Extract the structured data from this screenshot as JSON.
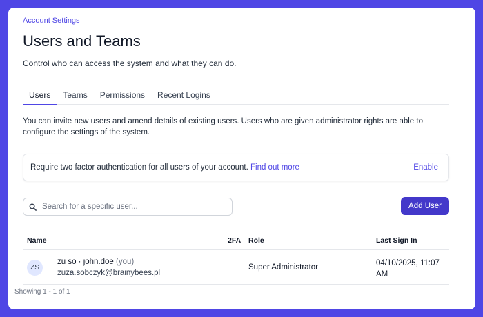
{
  "breadcrumb": "Account Settings",
  "page_title": "Users and Teams",
  "subtitle": "Control who can access the system and what they can do.",
  "tabs": [
    {
      "label": "Users",
      "active": true
    },
    {
      "label": "Teams",
      "active": false
    },
    {
      "label": "Permissions",
      "active": false
    },
    {
      "label": "Recent Logins",
      "active": false
    }
  ],
  "intro": "You can invite new users and amend details of existing users. Users who are given administrator rights are able to configure the settings of the system.",
  "notice": {
    "text": "Require two factor authentication for all users of your account.",
    "link": "Find out more",
    "action": "Enable"
  },
  "search": {
    "placeholder": "Search for a specific user...",
    "value": "",
    "icon": "search-icon"
  },
  "add_user_label": "Add User",
  "table": {
    "headers": {
      "name": "Name",
      "twofa": "2FA",
      "role": "Role",
      "last_sign_in": "Last Sign In"
    },
    "rows": [
      {
        "initials": "ZS",
        "name": "zu so · john.doe",
        "you_tag": "(you)",
        "email": "zuza.sobczyk@brainybees.pl",
        "twofa": "",
        "role": "Super Administrator",
        "last_sign_in": "04/10/2025, 11:07 AM"
      }
    ]
  },
  "footer": "Showing 1 - 1 of 1",
  "colors": {
    "accent": "#4f46e5",
    "background": "#4f46e5",
    "button": "#4338ca"
  }
}
